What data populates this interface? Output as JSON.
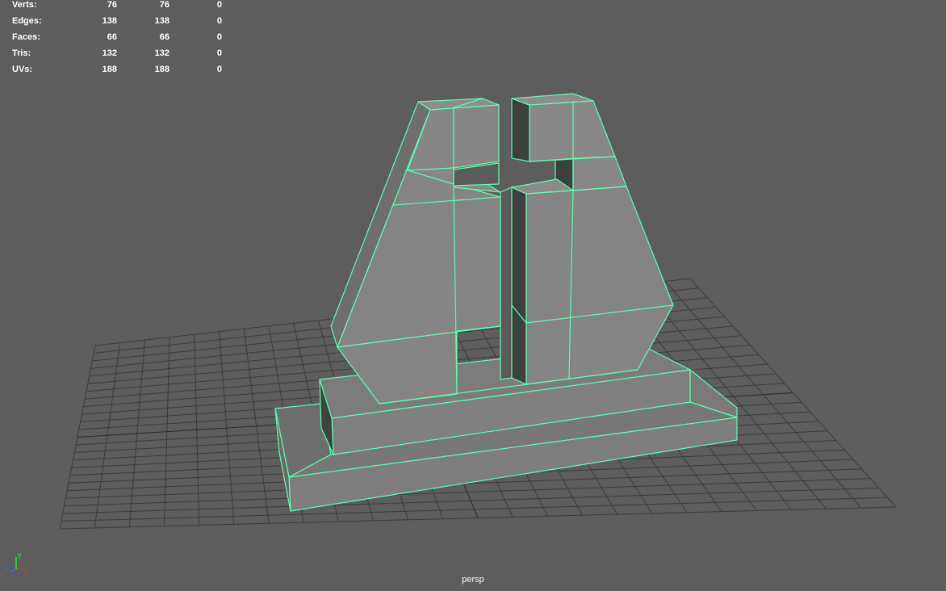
{
  "stats": {
    "rows": [
      {
        "label": "Verts:",
        "v1": "76",
        "v2": "76",
        "v3": "0"
      },
      {
        "label": "Edges:",
        "v1": "138",
        "v2": "138",
        "v3": "0"
      },
      {
        "label": "Faces:",
        "v1": "66",
        "v2": "66",
        "v3": "0"
      },
      {
        "label": "Tris:",
        "v1": "132",
        "v2": "132",
        "v3": "0"
      },
      {
        "label": "UVs:",
        "v1": "188",
        "v2": "188",
        "v3": "0"
      }
    ]
  },
  "viewport": {
    "camera": "persp",
    "background_color": "#5d5d5d",
    "grid_color": "#3c3c3c",
    "wireframe_color": "#5dfcb0",
    "mesh_face_color": "#7e7e7e"
  },
  "axis_gizmo": {
    "x": "x",
    "y": "y",
    "z": "z"
  }
}
